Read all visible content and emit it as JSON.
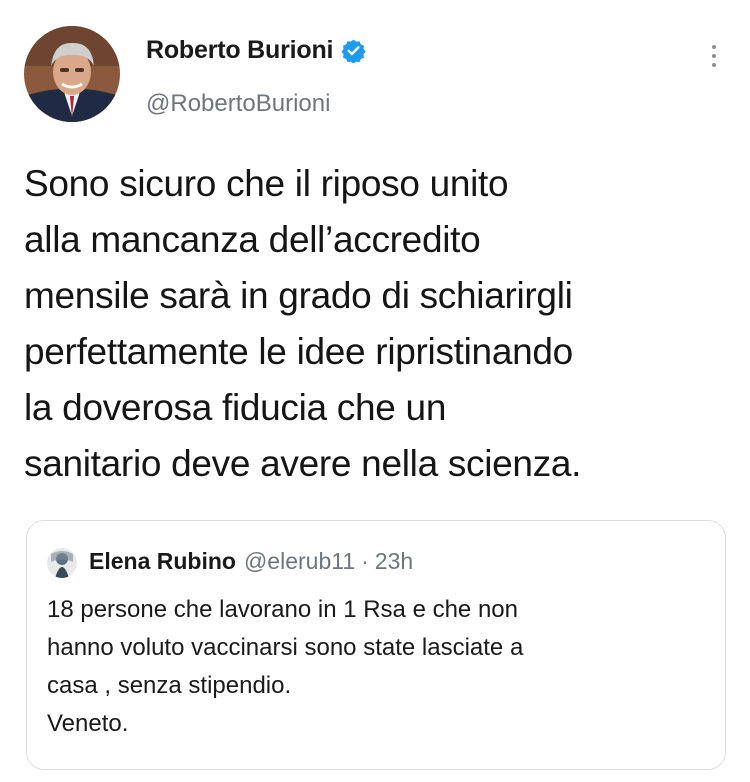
{
  "tweet": {
    "author": {
      "display_name": "Roberto Burioni",
      "handle": "@RobertoBurioni",
      "verified": true,
      "avatar_icon": "profile-photo"
    },
    "more_icon": "more-vertical-icon",
    "text": "Sono sicuro che il riposo unito\nalla mancanza dell’accredito\nmensile sarà in grado di schiarirgli\nperfettamente le idee ripristinando\nla doverosa fiducia che un\nsanitario deve avere nella scienza.",
    "quoted": {
      "display_name": "Elena Rubino",
      "handle": "@elerub11",
      "separator": "·",
      "time": "23h",
      "text": "18 persone che lavorano in 1 Rsa e che non\nhanno voluto vaccinarsi sono state lasciate a\ncasa , senza stipendio.\nVeneto."
    }
  },
  "colors": {
    "verified_badge": "#1d9bf0",
    "secondary_text": "#6e767d",
    "primary_text": "#151515",
    "border": "#dcdfe2"
  }
}
